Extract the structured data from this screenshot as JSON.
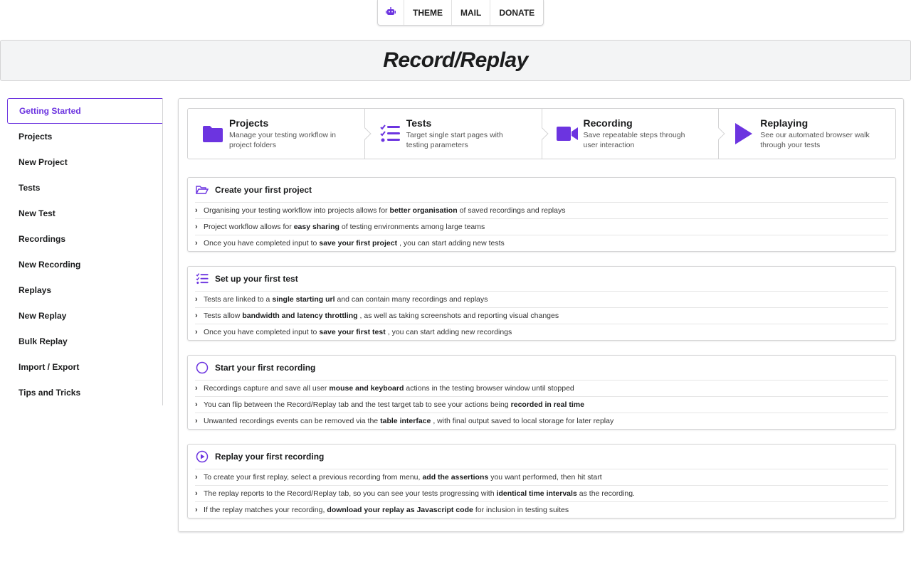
{
  "topmenu": {
    "icon": "robot-icon",
    "items": [
      "THEME",
      "MAIL",
      "DONATE"
    ]
  },
  "header": {
    "title": "Record/Replay"
  },
  "sidebar": {
    "items": [
      {
        "label": "Getting Started",
        "active": true
      },
      {
        "label": "Projects"
      },
      {
        "label": "New Project"
      },
      {
        "label": "Tests"
      },
      {
        "label": "New Test"
      },
      {
        "label": "Recordings"
      },
      {
        "label": "New Recording"
      },
      {
        "label": "Replays"
      },
      {
        "label": "New Replay"
      },
      {
        "label": "Bulk Replay"
      },
      {
        "label": "Import / Export"
      },
      {
        "label": "Tips and Tricks"
      }
    ]
  },
  "steps": [
    {
      "title": "Projects",
      "desc": "Manage your testing workflow in project folders",
      "icon": "folder-icon"
    },
    {
      "title": "Tests",
      "desc": "Target single start pages with testing parameters",
      "icon": "tasks-icon"
    },
    {
      "title": "Recording",
      "desc": "Save repeatable steps through user interaction",
      "icon": "video-camera-icon"
    },
    {
      "title": "Replaying",
      "desc": "See our automated browser walk through your tests",
      "icon": "play-icon"
    }
  ],
  "sections": [
    {
      "title": "Create your first project",
      "icon": "folder-open-outline-icon",
      "rows": [
        {
          "pre": "Organising your testing workflow into projects allows for",
          "bold": "better organisation",
          "post": "of saved recordings and replays"
        },
        {
          "pre": "Project workflow allows for",
          "bold": "easy sharing",
          "post": "of testing environments among large teams"
        },
        {
          "pre": "Once you have completed input to",
          "bold": "save your first project",
          "post": ", you can start adding new tests"
        }
      ]
    },
    {
      "title": "Set up your first test",
      "icon": "tasks-icon",
      "rows": [
        {
          "pre": "Tests are linked to a",
          "bold": "single starting url",
          "post": "and can contain many recordings and replays"
        },
        {
          "pre": "Tests allow",
          "bold": "bandwidth and latency throttling",
          "post": ", as well as taking screenshots and reporting visual changes"
        },
        {
          "pre": "Once you have completed input to",
          "bold": "save your first test",
          "post": ", you can start adding new recordings"
        }
      ]
    },
    {
      "title": "Start your first recording",
      "icon": "circle-outline-icon",
      "rows": [
        {
          "pre": "Recordings capture and save all user",
          "bold": "mouse and keyboard",
          "post": "actions in the testing browser window until stopped"
        },
        {
          "pre": "You can flip between the Record/Replay tab and the test target tab to see your actions being",
          "bold": "recorded in real time",
          "post": ""
        },
        {
          "pre": "Unwanted recordings events can be removed via the",
          "bold": "table interface",
          "post": ", with final output saved to local storage for later replay"
        }
      ]
    },
    {
      "title": "Replay your first recording",
      "icon": "play-circle-outline-icon",
      "rows": [
        {
          "pre": "To create your first replay, select a previous recording from menu,",
          "bold": "add the assertions",
          "post": "you want performed, then hit start"
        },
        {
          "pre": "The replay reports to the Record/Replay tab, so you can see your tests progressing with",
          "bold": "identical time intervals",
          "post": "as the recording."
        },
        {
          "pre": "If the replay matches your recording,",
          "bold": "download your replay as Javascript code",
          "post": "for inclusion in testing suites"
        }
      ]
    }
  ],
  "accent_color": "#6c34e0"
}
